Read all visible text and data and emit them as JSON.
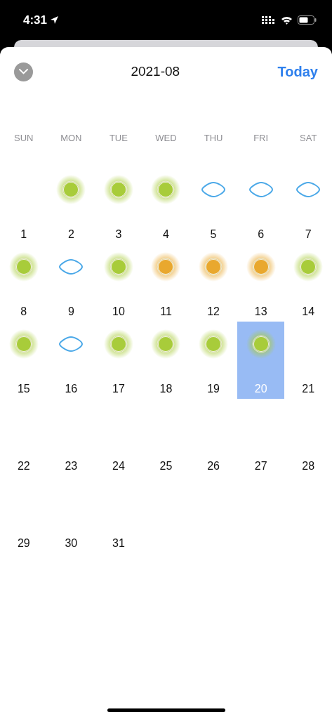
{
  "status_bar": {
    "time": "4:31"
  },
  "header": {
    "title": "2021-08",
    "today_button": "Today"
  },
  "weekdays": [
    "SUN",
    "MON",
    "TUE",
    "WED",
    "THU",
    "FRI",
    "SAT"
  ],
  "days": [
    {
      "label": "1",
      "kind": "none",
      "selected": false
    },
    {
      "label": "2",
      "kind": "sun",
      "color": "#a8cc3a",
      "selected": false
    },
    {
      "label": "3",
      "kind": "sun",
      "color": "#a8cc3a",
      "selected": false
    },
    {
      "label": "4",
      "kind": "sun",
      "color": "#a8cc3a",
      "selected": false
    },
    {
      "label": "5",
      "kind": "cloud",
      "selected": false
    },
    {
      "label": "6",
      "kind": "cloud",
      "selected": false
    },
    {
      "label": "7",
      "kind": "cloud",
      "selected": false
    },
    {
      "label": "8",
      "kind": "sun",
      "color": "#a8cc3a",
      "selected": false
    },
    {
      "label": "9",
      "kind": "cloud",
      "selected": false
    },
    {
      "label": "10",
      "kind": "sun",
      "color": "#a8cc3a",
      "selected": false
    },
    {
      "label": "11",
      "kind": "sun",
      "color": "#e9a82e",
      "selected": false
    },
    {
      "label": "12",
      "kind": "sun",
      "color": "#e9a82e",
      "selected": false
    },
    {
      "label": "13",
      "kind": "sun",
      "color": "#e9a82e",
      "selected": false
    },
    {
      "label": "14",
      "kind": "sun",
      "color": "#a8cc3a",
      "selected": false
    },
    {
      "label": "15",
      "kind": "sun",
      "color": "#a8cc3a",
      "selected": false
    },
    {
      "label": "16",
      "kind": "cloud",
      "selected": false
    },
    {
      "label": "17",
      "kind": "sun",
      "color": "#a8cc3a",
      "selected": false
    },
    {
      "label": "18",
      "kind": "sun",
      "color": "#a8cc3a",
      "selected": false
    },
    {
      "label": "19",
      "kind": "sun",
      "color": "#a8cc3a",
      "selected": false
    },
    {
      "label": "20",
      "kind": "sun",
      "color": "#a8cc3a",
      "selected": true
    },
    {
      "label": "21",
      "kind": "none",
      "selected": false
    },
    {
      "label": "22",
      "kind": "none",
      "selected": false
    },
    {
      "label": "23",
      "kind": "none",
      "selected": false
    },
    {
      "label": "24",
      "kind": "none",
      "selected": false
    },
    {
      "label": "25",
      "kind": "none",
      "selected": false
    },
    {
      "label": "26",
      "kind": "none",
      "selected": false
    },
    {
      "label": "27",
      "kind": "none",
      "selected": false
    },
    {
      "label": "28",
      "kind": "none",
      "selected": false
    },
    {
      "label": "29",
      "kind": "none",
      "selected": false
    },
    {
      "label": "30",
      "kind": "none",
      "selected": false
    },
    {
      "label": "31",
      "kind": "none",
      "selected": false
    }
  ]
}
